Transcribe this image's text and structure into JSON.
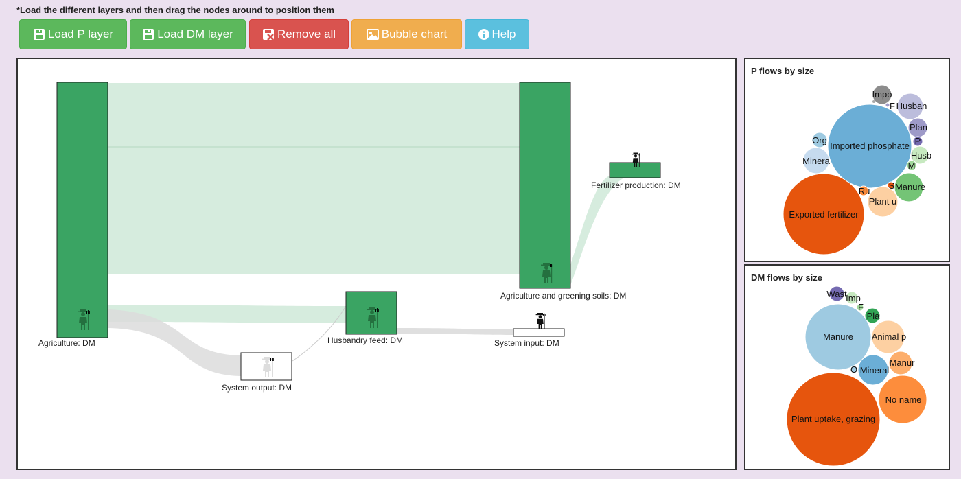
{
  "instructions": "*Load the different layers and then drag the nodes around to position them",
  "toolbar": {
    "load_p": "Load P layer",
    "load_dm": "Load DM layer",
    "remove_all": "Remove all",
    "bubble_chart": "Bubble chart",
    "help": "Help"
  },
  "colors": {
    "button_green": "#5cb85c",
    "button_red": "#d9534f",
    "button_orange": "#f0ad4e",
    "button_blue": "#5bc0de",
    "node_green": "#3aa463",
    "link_green": "#cfe9d8",
    "link_gray": "#dcdcdc"
  },
  "sankey": {
    "nodes": [
      {
        "label": "Agriculture: DM",
        "icon": "farmer-icon"
      },
      {
        "label": "Agriculture and greening soils: DM",
        "icon": "farmer-icon"
      },
      {
        "label": "Fertilizer production: DM",
        "icon": "farmer-icon"
      },
      {
        "label": "Husbandry feed: DM",
        "icon": "farmer-icon"
      },
      {
        "label": "System input: DM",
        "icon": "farmer-icon"
      },
      {
        "label": "System output: DM",
        "icon": "farmer-icon"
      }
    ]
  },
  "p_flows": {
    "title": "P flows by size",
    "bubbles": [
      {
        "label": "Impo",
        "color": "#8c8c8c"
      },
      {
        "label": "F",
        "color": "#9e9ac8"
      },
      {
        "label": "Husban",
        "color": "#bcbddc"
      },
      {
        "label": "Plan",
        "color": "#9e9ac8"
      },
      {
        "label": "P",
        "color": "#756bb1"
      },
      {
        "label": "Org",
        "color": "#9ecae1"
      },
      {
        "label": "Imported phosphate",
        "color": "#6baed6"
      },
      {
        "label": "Husb",
        "color": "#c7e9c0"
      },
      {
        "label": "M",
        "color": "#a1d99b"
      },
      {
        "label": "Minera",
        "color": "#c6dbef"
      },
      {
        "label": "Manure",
        "color": "#74c476"
      },
      {
        "label": "S",
        "color": "#e6550d"
      },
      {
        "label": "Ru",
        "color": "#fd8d3c"
      },
      {
        "label": "Plant u",
        "color": "#fdd0a2"
      },
      {
        "label": "Exported fertilizer",
        "color": "#e6550d"
      }
    ]
  },
  "dm_flows": {
    "title": "DM flows by size",
    "bubbles": [
      {
        "label": "Wast",
        "color": "#756bb1"
      },
      {
        "label": "Imp",
        "color": "#c7e9c0"
      },
      {
        "label": "F",
        "color": "#a1d99b"
      },
      {
        "label": "Pla",
        "color": "#31a354"
      },
      {
        "label": "Manure",
        "color": "#9ecae1"
      },
      {
        "label": "Animal p",
        "color": "#fdd0a2"
      },
      {
        "label": "Manur",
        "color": "#fdae6b"
      },
      {
        "label": "O",
        "color": "#9ecae1"
      },
      {
        "label": "Mineral",
        "color": "#6baed6"
      },
      {
        "label": "No name",
        "color": "#fd8d3c"
      },
      {
        "label": "Plant uptake, grazing",
        "color": "#e6550d"
      }
    ]
  }
}
